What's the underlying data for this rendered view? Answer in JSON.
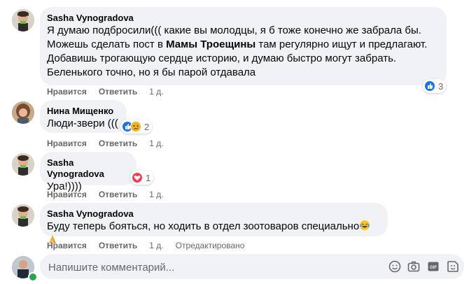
{
  "comments": [
    {
      "author": "Sasha Vynogradova",
      "lines": [
        "Я думаю подбросили((( какие вы молодцы, я б тоже конечно же забрала бы.",
        "Беленького точно, но я бы парой отдавала"
      ],
      "line2_before": "Можешь сделать пост в ",
      "line2_bold": "Мамы Троещины",
      "line2_after": " там регулярно ищут и предлагают.",
      "line3": "Добавишь трогающую сердце историю, и думаю быстро могут забрать.",
      "like_label": "Нравится",
      "reply_label": "Ответить",
      "time": "1 д.",
      "reaction_count": "3"
    },
    {
      "author": "Нина Мищенко",
      "text": "Люди-звери (((",
      "like_label": "Нравится",
      "reply_label": "Ответить",
      "time": "1 д.",
      "reaction_count": "2"
    },
    {
      "author": "Sasha Vynogradova",
      "text": "Ура!))))",
      "like_label": "Нравится",
      "reply_label": "Ответить",
      "time": "1 д.",
      "reaction_count": "1"
    },
    {
      "author": "Sasha Vynogradova",
      "text": "Буду теперь бояться, но ходить в отдел зоотоваров специально",
      "like_label": "Нравится",
      "reply_label": "Ответить",
      "time": "1 д.",
      "edited": "Отредактировано"
    }
  ],
  "composer": {
    "placeholder": "Напишите комментарий...",
    "tools": [
      "emoji-icon",
      "camera-icon",
      "gif-icon",
      "sticker-icon"
    ]
  },
  "colors": {
    "bubble": "#f0f2f5",
    "meta": "#65676b",
    "like": "#1b74e4",
    "love": "#f33e58",
    "online": "#31a24c"
  }
}
